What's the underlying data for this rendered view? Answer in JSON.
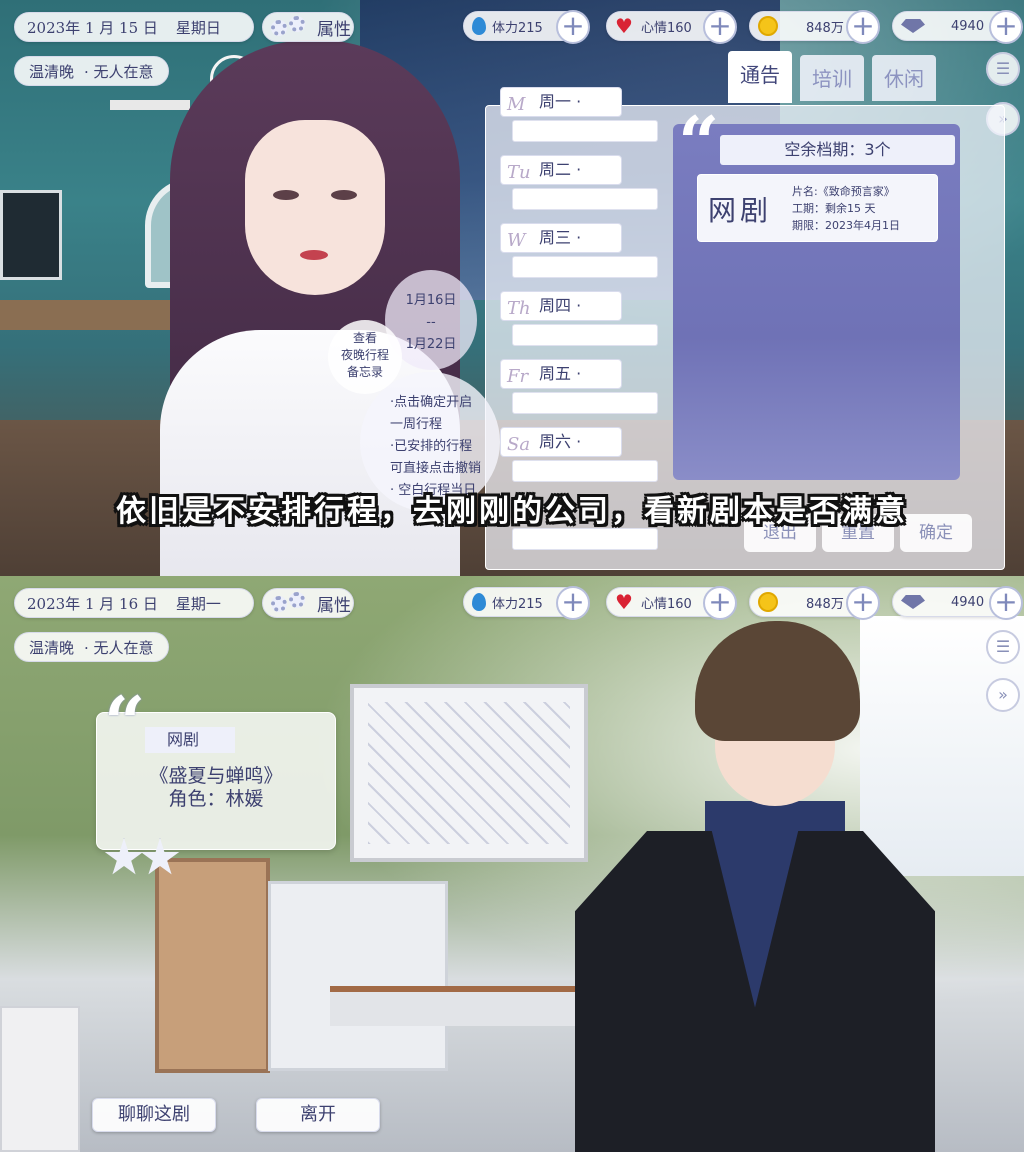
{
  "panel1": {
    "hud": {
      "date": "2023年 1 月 15 日",
      "weekday": "星期日",
      "attr_label": "属性",
      "stamina": "体力215",
      "mood": "心情160",
      "coins": "848万",
      "gems": "4940",
      "plus": "+"
    },
    "player": {
      "name": "温清晚",
      "trait": "· 无人在意"
    },
    "tabs": [
      "通告",
      "培训",
      "休闲"
    ],
    "days": [
      {
        "mark": "M",
        "label": "周一 ·"
      },
      {
        "mark": "Tu",
        "label": "周二 ·"
      },
      {
        "mark": "W",
        "label": "周三 ·"
      },
      {
        "mark": "Th",
        "label": "周四 ·"
      },
      {
        "mark": "Fr",
        "label": "周五 ·"
      },
      {
        "mark": "Sa",
        "label": "周六 ·"
      }
    ],
    "vacancy": "空余档期：3个",
    "drama": {
      "type": "网剧",
      "title": "片名:《致命预言家》",
      "period": "工期：剩余15 天",
      "deadline": "期限：2023年4月1日"
    },
    "week_range": {
      "start": "1月16日",
      "sep": "--",
      "end": "1月22日"
    },
    "memo": {
      "line1": "查看",
      "line2": "夜晚行程",
      "line3": "备忘录"
    },
    "tips": [
      "·点击确定开启",
      "一周行程",
      "·已安排的行程",
      "可直接点击撤销",
      "· 空白行程当日"
    ],
    "buttons": {
      "exit": "退出",
      "reset": "重置",
      "confirm": "确定"
    },
    "subtitle": "依旧是不安排行程，去刚刚的公司，看新剧本是否满意"
  },
  "panel2": {
    "hud": {
      "date": "2023年 1 月 16 日",
      "weekday": "星期一",
      "attr_label": "属性",
      "stamina": "体力215",
      "mood": "心情160",
      "coins": "848万",
      "gems": "4940",
      "plus": "+"
    },
    "player": {
      "name": "温清晚",
      "trait": "· 无人在意"
    },
    "script": {
      "type": "网剧",
      "title": "《盛夏与蝉鸣》",
      "role": "角色：林媛"
    },
    "buttons": {
      "chat": "聊聊这剧",
      "leave": "离开"
    }
  },
  "colors": {
    "accent": "#7a7dc0",
    "text": "#3d4170",
    "heart": "#d92334",
    "coin": "#f5c419",
    "drop": "#2e8ad6"
  }
}
